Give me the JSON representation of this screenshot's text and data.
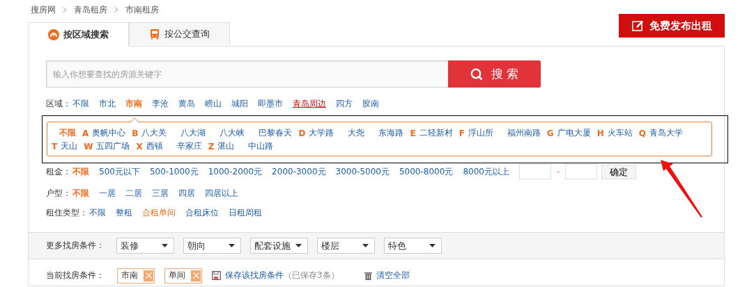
{
  "breadcrumb": [
    "搜房网",
    "青岛租房",
    "市南租房"
  ],
  "tabs": [
    {
      "label": "按区域搜索",
      "selected": true
    },
    {
      "label": "按公交查询",
      "selected": false
    }
  ],
  "publish_button": "免费发布出租",
  "search": {
    "placeholder": "输入你想要查找的房源关键字",
    "button": "搜 索"
  },
  "region": {
    "label": "区域：",
    "options": [
      {
        "label": "不限",
        "selected": false,
        "kind": "link"
      },
      {
        "label": "市北",
        "selected": false,
        "kind": "link"
      },
      {
        "label": "市南",
        "selected": true,
        "kind": "link"
      },
      {
        "label": "李沧",
        "selected": false,
        "kind": "link"
      },
      {
        "label": "黄岛",
        "selected": false,
        "kind": "link"
      },
      {
        "label": "崂山",
        "selected": false,
        "kind": "link"
      },
      {
        "label": "城阳",
        "selected": false,
        "kind": "link"
      },
      {
        "label": "即墨市",
        "selected": false,
        "kind": "link"
      },
      {
        "label": "青岛周边",
        "selected": false,
        "kind": "hot"
      },
      {
        "label": "四方",
        "selected": false,
        "kind": "link"
      },
      {
        "label": "胶南",
        "selected": false,
        "kind": "link"
      }
    ]
  },
  "sub_areas": {
    "lines": [
      {
        "items": [
          {
            "label": "不限",
            "selected": true
          },
          {
            "letter": "A",
            "label": "奥帆中心",
            "selected": false
          },
          {
            "letter": "B",
            "label": "八大关",
            "selected": false
          },
          {
            "label": "八大湖",
            "selected": false
          },
          {
            "label": "八大峡",
            "selected": false
          },
          {
            "label": "巴黎春天",
            "selected": false
          },
          {
            "letter": "D",
            "label": "大学路",
            "selected": false
          },
          {
            "label": "大尧",
            "selected": false
          },
          {
            "label": "东海路",
            "selected": false
          },
          {
            "letter": "E",
            "label": "二轻新村",
            "selected": false
          },
          {
            "letter": "F",
            "label": "浮山所",
            "selected": false
          },
          {
            "label": "福州南路",
            "selected": false
          },
          {
            "letter": "G",
            "label": "广电大厦",
            "selected": false
          },
          {
            "letter": "H",
            "label": "火车站",
            "selected": false
          },
          {
            "letter": "Q",
            "label": "青岛大学",
            "selected": false
          }
        ]
      },
      {
        "items": [
          {
            "letter": "T",
            "label": "天山",
            "selected": false
          },
          {
            "letter": "W",
            "label": "五四广场",
            "selected": false
          },
          {
            "letter": "X",
            "label": "西镇",
            "selected": false
          },
          {
            "label": "辛家庄",
            "selected": false
          },
          {
            "letter": "Z",
            "label": "湛山",
            "selected": false
          },
          {
            "label": "中山路",
            "selected": false
          }
        ]
      }
    ]
  },
  "rent": {
    "label": "租金：",
    "options": [
      {
        "label": "不限",
        "selected": true,
        "kind": "link"
      },
      {
        "label": "500元以下",
        "selected": false,
        "kind": "link"
      },
      {
        "label": "500-1000元",
        "selected": false,
        "kind": "link"
      },
      {
        "label": "1000-2000元",
        "selected": false,
        "kind": "link"
      },
      {
        "label": "2000-3000元",
        "selected": false,
        "kind": "link"
      },
      {
        "label": "3000-5000元",
        "selected": false,
        "kind": "link"
      },
      {
        "label": "5000-8000元",
        "selected": false,
        "kind": "link"
      },
      {
        "label": "8000元以上",
        "selected": false,
        "kind": "link"
      }
    ],
    "range_separator": "-",
    "confirm_button": "确定"
  },
  "layout": {
    "label": "户型：",
    "options": [
      {
        "label": "不限",
        "selected": true,
        "kind": "link"
      },
      {
        "label": "一居",
        "selected": false,
        "kind": "link"
      },
      {
        "label": "二居",
        "selected": false,
        "kind": "link"
      },
      {
        "label": "三居",
        "selected": false,
        "kind": "link"
      },
      {
        "label": "四居",
        "selected": false,
        "kind": "link"
      },
      {
        "label": "四居以上",
        "selected": false,
        "kind": "link"
      }
    ]
  },
  "rental_type": {
    "label": "租住类型：",
    "options": [
      {
        "label": "不限",
        "selected": false,
        "kind": "link"
      },
      {
        "label": "整租",
        "selected": false,
        "kind": "link"
      },
      {
        "label": "合租单间",
        "selected": true,
        "kind": "link"
      },
      {
        "label": "合租床位",
        "selected": false,
        "kind": "link"
      },
      {
        "label": "日租周租",
        "selected": false,
        "kind": "link"
      }
    ]
  },
  "more_conditions": {
    "label": "更多找房条件：",
    "dropdowns": [
      "装修",
      "朝向",
      "配套设施",
      "楼层",
      "特色"
    ]
  },
  "current_conditions": {
    "label": "当前找房条件：",
    "tags": [
      "市南",
      "单间"
    ],
    "save_link": "保存该找房条件",
    "saved_note": "（已保存3条）",
    "clear_link": "清空全部"
  }
}
